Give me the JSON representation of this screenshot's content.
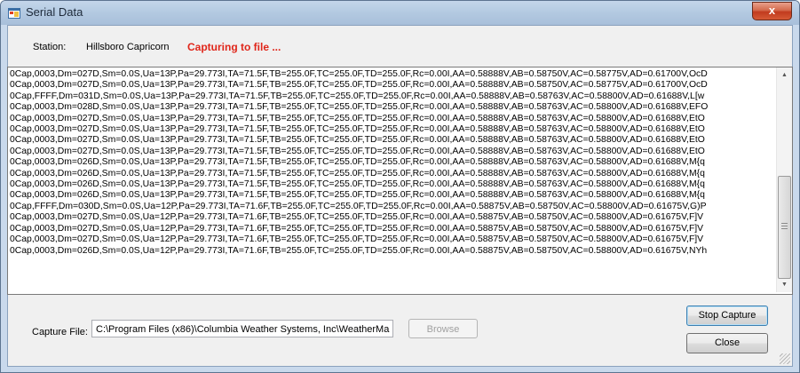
{
  "window": {
    "title": "Serial Data",
    "close_glyph": "x"
  },
  "header": {
    "station_label": "Station:",
    "station_name": "Hillsboro Capricorn",
    "status": "Capturing to file ..."
  },
  "log": {
    "lines": [
      "0Cap,0003,Dm=027D,Sm=0.0S,Ua=13P,Pa=29.773I,TA=71.5F,TB=255.0F,TC=255.0F,TD=255.0F,Rc=0.00I,AA=0.58888V,AB=0.58750V,AC=0.58775V,AD=0.61700V,OcD",
      "0Cap,0003,Dm=027D,Sm=0.0S,Ua=13P,Pa=29.773I,TA=71.5F,TB=255.0F,TC=255.0F,TD=255.0F,Rc=0.00I,AA=0.58888V,AB=0.58750V,AC=0.58775V,AD=0.61700V,OcD",
      "0Cap,FFFF,Dm=031D,Sm=0.0S,Ua=13P,Pa=29.773I,TA=71.5F,TB=255.0F,TC=255.0F,TD=255.0F,Rc=0.00I,AA=0.58888V,AB=0.58763V,AC=0.58800V,AD=0.61688V,L[w",
      "0Cap,0003,Dm=028D,Sm=0.0S,Ua=13P,Pa=29.773I,TA=71.5F,TB=255.0F,TC=255.0F,TD=255.0F,Rc=0.00I,AA=0.58888V,AB=0.58763V,AC=0.58800V,AD=0.61688V,EFO",
      "0Cap,0003,Dm=027D,Sm=0.0S,Ua=13P,Pa=29.773I,TA=71.5F,TB=255.0F,TC=255.0F,TD=255.0F,Rc=0.00I,AA=0.58888V,AB=0.58763V,AC=0.58800V,AD=0.61688V,EtO",
      "0Cap,0003,Dm=027D,Sm=0.0S,Ua=13P,Pa=29.773I,TA=71.5F,TB=255.0F,TC=255.0F,TD=255.0F,Rc=0.00I,AA=0.58888V,AB=0.58763V,AC=0.58800V,AD=0.61688V,EtO",
      "0Cap,0003,Dm=027D,Sm=0.0S,Ua=13P,Pa=29.773I,TA=71.5F,TB=255.0F,TC=255.0F,TD=255.0F,Rc=0.00I,AA=0.58888V,AB=0.58763V,AC=0.58800V,AD=0.61688V,EtO",
      "0Cap,0003,Dm=027D,Sm=0.0S,Ua=13P,Pa=29.773I,TA=71.5F,TB=255.0F,TC=255.0F,TD=255.0F,Rc=0.00I,AA=0.58888V,AB=0.58763V,AC=0.58800V,AD=0.61688V,EtO",
      "0Cap,0003,Dm=026D,Sm=0.0S,Ua=13P,Pa=29.773I,TA=71.5F,TB=255.0F,TC=255.0F,TD=255.0F,Rc=0.00I,AA=0.58888V,AB=0.58763V,AC=0.58800V,AD=0.61688V,M{q",
      "0Cap,0003,Dm=026D,Sm=0.0S,Ua=13P,Pa=29.773I,TA=71.5F,TB=255.0F,TC=255.0F,TD=255.0F,Rc=0.00I,AA=0.58888V,AB=0.58763V,AC=0.58800V,AD=0.61688V,M{q",
      "0Cap,0003,Dm=026D,Sm=0.0S,Ua=13P,Pa=29.773I,TA=71.5F,TB=255.0F,TC=255.0F,TD=255.0F,Rc=0.00I,AA=0.58888V,AB=0.58763V,AC=0.58800V,AD=0.61688V,M{q",
      "0Cap,0003,Dm=026D,Sm=0.0S,Ua=13P,Pa=29.773I,TA=71.5F,TB=255.0F,TC=255.0F,TD=255.0F,Rc=0.00I,AA=0.58888V,AB=0.58763V,AC=0.58800V,AD=0.61688V,M{q",
      "0Cap,FFFF,Dm=030D,Sm=0.0S,Ua=12P,Pa=29.773I,TA=71.6F,TB=255.0F,TC=255.0F,TD=255.0F,Rc=0.00I,AA=0.58875V,AB=0.58750V,AC=0.58800V,AD=0.61675V,G)P",
      "0Cap,0003,Dm=027D,Sm=0.0S,Ua=12P,Pa=29.773I,TA=71.6F,TB=255.0F,TC=255.0F,TD=255.0F,Rc=0.00I,AA=0.58875V,AB=0.58750V,AC=0.58800V,AD=0.61675V,F]V",
      "0Cap,0003,Dm=027D,Sm=0.0S,Ua=12P,Pa=29.773I,TA=71.6F,TB=255.0F,TC=255.0F,TD=255.0F,Rc=0.00I,AA=0.58875V,AB=0.58750V,AC=0.58800V,AD=0.61675V,F]V",
      "0Cap,0003,Dm=027D,Sm=0.0S,Ua=12P,Pa=29.773I,TA=71.6F,TB=255.0F,TC=255.0F,TD=255.0F,Rc=0.00I,AA=0.58875V,AB=0.58750V,AC=0.58800V,AD=0.61675V,F]V",
      "0Cap,0003,Dm=026D,Sm=0.0S,Ua=12P,Pa=29.773I,TA=71.6F,TB=255.0F,TC=255.0F,TD=255.0F,Rc=0.00I,AA=0.58875V,AB=0.58750V,AC=0.58800V,AD=0.61675V,NYh"
    ],
    "scroll_up_glyph": "▲",
    "scroll_down_glyph": "▼"
  },
  "footer": {
    "capture_label": "Capture File:",
    "capture_path": "C:\\Program Files (x86)\\Columbia Weather Systems, Inc\\WeatherMa",
    "browse_label": "Browse",
    "stop_label": "Stop Capture",
    "close_label": "Close"
  },
  "colors": {
    "status": "#e0261a",
    "titlebar": "#b3c9e1",
    "close_button": "#c23b1e"
  }
}
